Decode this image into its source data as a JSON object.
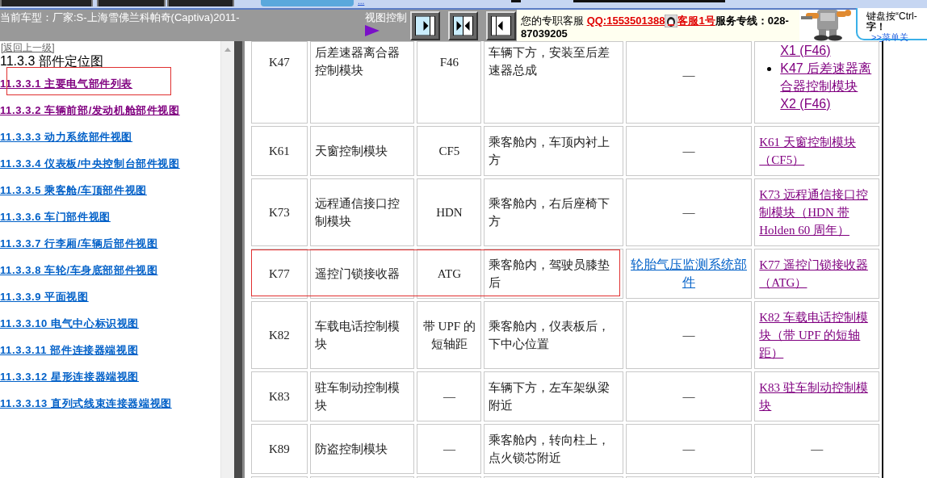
{
  "top_toolbar": {
    "more_link": "..."
  },
  "header": {
    "current_model": "当前车型：厂家:S-上海雪佛兰科帕奇(Captiva)2011-",
    "view_control_label": "视图控制"
  },
  "contact": {
    "label": "您的专职客服",
    "qq": "QQ:1553501388",
    "agent": "客服1号",
    "hotline": "服务专线：028-87039205"
  },
  "tip": {
    "line_1": "键盘按“Ctrl-",
    "line_2": "字！",
    "link": ">>菜单关"
  },
  "sidebar": {
    "back_link": "[返回上一级]",
    "title": "11.3.3 部件定位图",
    "items": [
      {
        "label": "11.3.3.1 主要电气部件列表",
        "visited": true,
        "marked": true
      },
      {
        "label": "11.3.3.2 车辆前部/发动机舱部件视图",
        "visited": true,
        "marked": false
      },
      {
        "label": "11.3.3.3 动力系统部件视图",
        "visited": false,
        "marked": false
      },
      {
        "label": "11.3.3.4 仪表板/中央控制台部件视图",
        "visited": false,
        "marked": false
      },
      {
        "label": "11.3.3.5 乘客舱/车顶部件视图",
        "visited": false,
        "marked": false
      },
      {
        "label": "11.3.3.6 车门部件视图",
        "visited": false,
        "marked": false
      },
      {
        "label": "11.3.3.7 行李厢/车辆后部件视图",
        "visited": false,
        "marked": false
      },
      {
        "label": "11.3.3.8 车轮/车身底部部件视图",
        "visited": false,
        "marked": false
      },
      {
        "label": "11.3.3.9 平面视图",
        "visited": false,
        "marked": false
      },
      {
        "label": "11.3.3.10 电气中心标识视图",
        "visited": false,
        "marked": false
      },
      {
        "label": "11.3.3.11 部件连接器端视图",
        "visited": false,
        "marked": false
      },
      {
        "label": "11.3.3.12 星形连接器端视图",
        "visited": false,
        "marked": false
      },
      {
        "label": "11.3.3.13 直列式线束连接器端视图",
        "visited": false,
        "marked": false
      }
    ]
  },
  "table": {
    "partial_row": true,
    "rows": [
      {
        "code": "K47",
        "name": "后差速器离合器控制模块",
        "connector": "F46",
        "location": "车辆下方，安装至后差速器总成",
        "column_5": {
          "kind": "text",
          "text": "—"
        },
        "column_6": {
          "kind": "list",
          "items": [
            {
              "text": "X1 (F46)",
              "bullet": false
            },
            {
              "text": "K47 后差速器离合器控制模块 X2 (F46)",
              "bullet": true
            }
          ]
        },
        "marked": false
      },
      {
        "code": "K61",
        "name": "天窗控制模块",
        "connector": "CF5",
        "location": "乘客舱内，车顶内衬上方",
        "column_5": {
          "kind": "text",
          "text": "—"
        },
        "column_6": {
          "kind": "link",
          "text": "K61 天窗控制模块（CF5）"
        },
        "marked": false
      },
      {
        "code": "K73",
        "name": "远程通信接口控制模块",
        "connector": "HDN",
        "location": "乘客舱内，右后座椅下方",
        "column_5": {
          "kind": "text",
          "text": "—"
        },
        "column_6": {
          "kind": "link",
          "text": "K73 远程通信接口控制模块（HDN 带 Holden 60 周年）"
        },
        "marked": false
      },
      {
        "code": "K77",
        "name": "遥控门锁接收器",
        "connector": "ATG",
        "location": "乘客舱内，驾驶员膝垫后",
        "column_5": {
          "kind": "link",
          "text": "轮胎气压监测系统部件"
        },
        "column_6": {
          "kind": "link",
          "text": "K77 遥控门锁接收器（ATG）"
        },
        "marked": true
      },
      {
        "code": "K82",
        "name": "车载电话控制模块",
        "connector": "带 UPF 的短轴距",
        "location": "乘客舱内，仪表板后，下中心位置",
        "column_5": {
          "kind": "text",
          "text": "—"
        },
        "column_6": {
          "kind": "link",
          "text": "K82 车载电话控制模块（带 UPF 的短轴距）"
        },
        "marked": false
      },
      {
        "code": "K83",
        "name": "驻车制动控制模块",
        "connector": "—",
        "location": "车辆下方，左车架纵梁附近",
        "column_5": {
          "kind": "text",
          "text": "—"
        },
        "column_6": {
          "kind": "link",
          "text": "K83 驻车制动控制模块"
        },
        "marked": false
      },
      {
        "code": "K89",
        "name": "防盗控制模块",
        "connector": "—",
        "location": "乘客舱内，转向柱上，点火锁芯附近",
        "column_5": {
          "kind": "text",
          "text": "—"
        },
        "column_6": {
          "kind": "text",
          "text": "—"
        },
        "marked": false
      }
    ]
  }
}
